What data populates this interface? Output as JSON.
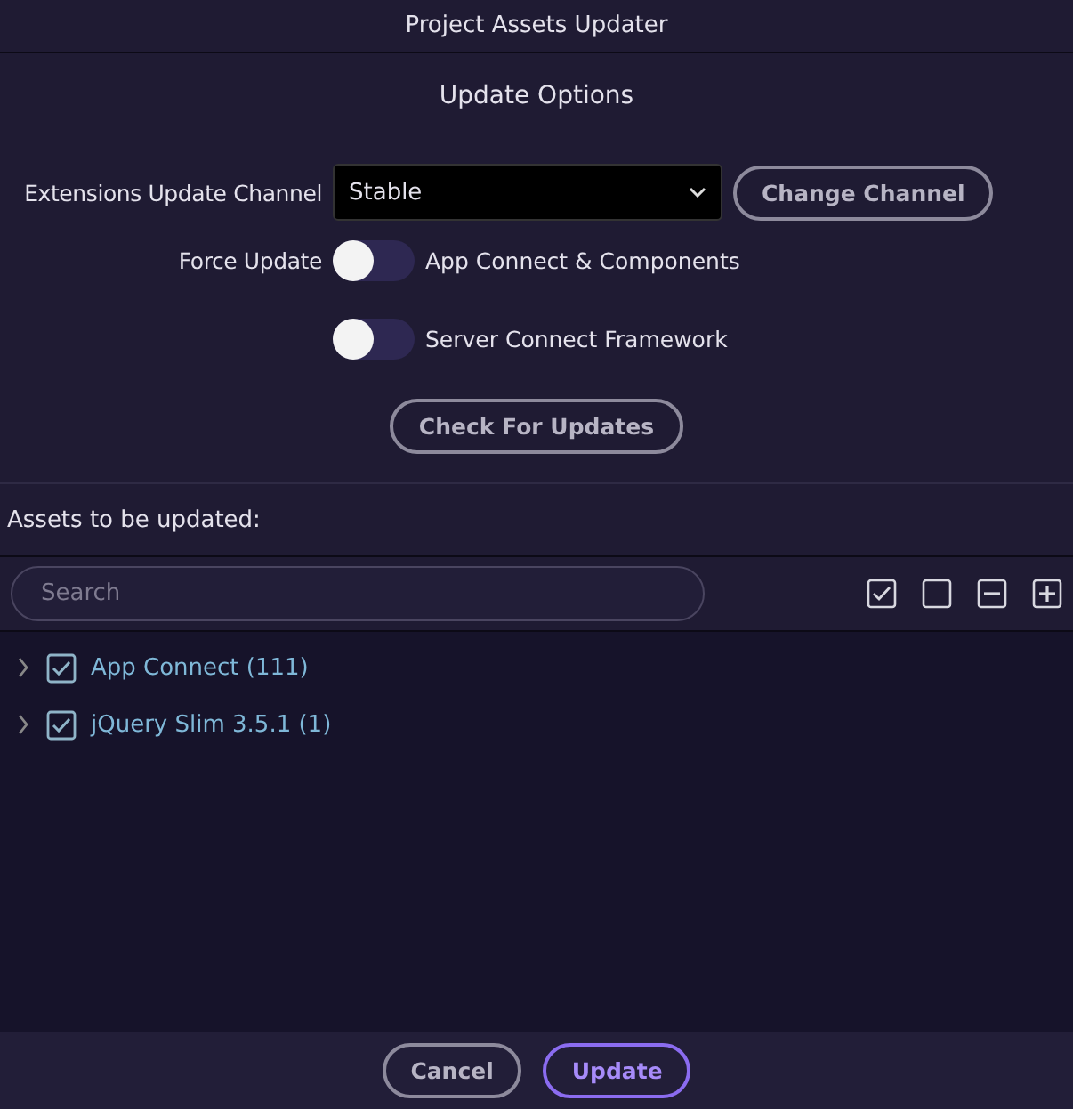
{
  "window": {
    "title": "Project Assets Updater"
  },
  "options": {
    "heading": "Update Options",
    "channel_label": "Extensions Update Channel",
    "channel_value": "Stable",
    "change_button": "Change Channel",
    "force_label": "Force Update",
    "toggles": [
      {
        "label": "App Connect & Components",
        "on": false
      },
      {
        "label": "Server Connect Framework",
        "on": false
      }
    ],
    "check_button": "Check For Updates"
  },
  "assets": {
    "heading": "Assets to be updated:",
    "search": {
      "placeholder": "Search"
    },
    "items": [
      {
        "label": "App Connect (111)",
        "checked": true,
        "expanded": false
      },
      {
        "label": "jQuery Slim 3.5.1 (1)",
        "checked": true,
        "expanded": false
      }
    ]
  },
  "buttons": [
    {
      "label": "Cancel",
      "kind": "secondary"
    },
    {
      "label": "Update",
      "kind": "primary"
    }
  ]
}
